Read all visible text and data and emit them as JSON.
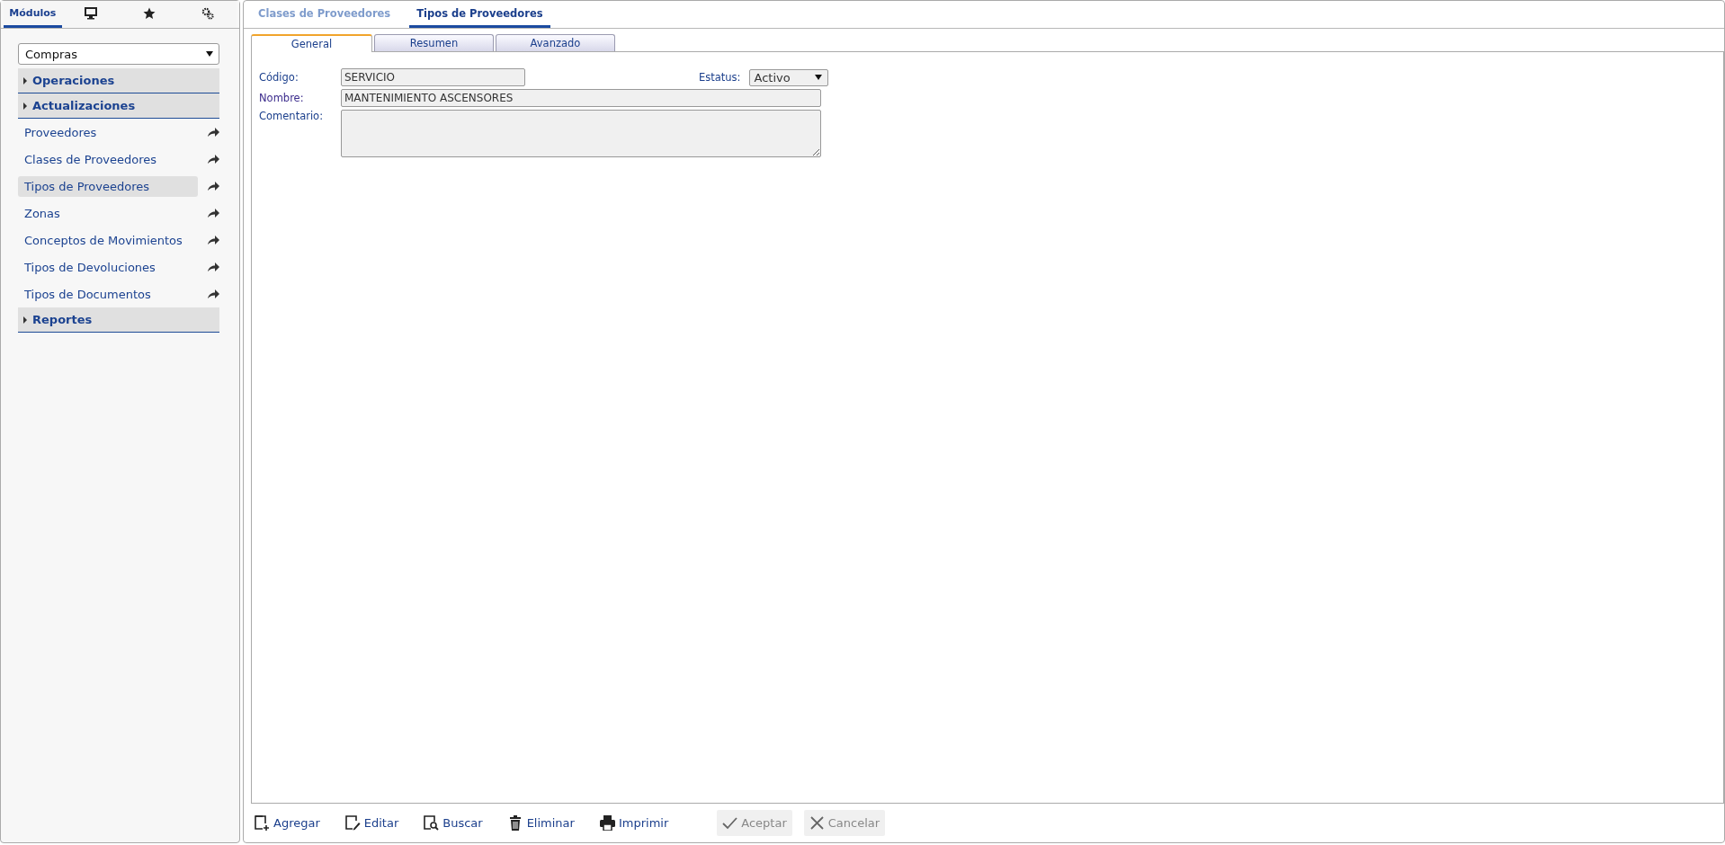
{
  "sidebar": {
    "tabs": [
      {
        "kind": "text",
        "label": "Módulos",
        "selected": true
      },
      {
        "kind": "monitor",
        "selected": false
      },
      {
        "kind": "star",
        "selected": false
      },
      {
        "kind": "gears",
        "selected": false
      }
    ],
    "module_select": {
      "value": "Compras"
    },
    "sections": [
      {
        "label": "Operaciones"
      },
      {
        "label": "Actualizaciones",
        "items": [
          {
            "label": "Proveedores",
            "selected": false
          },
          {
            "label": "Clases de Proveedores",
            "selected": false
          },
          {
            "label": "Tipos de Proveedores",
            "selected": true
          },
          {
            "label": "Zonas",
            "selected": false
          },
          {
            "label": "Conceptos de Movimientos",
            "selected": false
          },
          {
            "label": "Tipos de Devoluciones",
            "selected": false
          },
          {
            "label": "Tipos de Documentos",
            "selected": false
          }
        ]
      },
      {
        "label": "Reportes"
      }
    ]
  },
  "document_tabs": [
    {
      "label": "Clases de Proveedores",
      "selected": false
    },
    {
      "label": "Tipos de Proveedores",
      "selected": true
    }
  ],
  "form_tabs": [
    {
      "label": "General",
      "selected": true
    },
    {
      "label": "Resumen",
      "selected": false
    },
    {
      "label": "Avanzado",
      "selected": false
    }
  ],
  "form": {
    "codigo": {
      "label": "Código:",
      "value": "SERVICIO"
    },
    "estatus": {
      "label": "Estatus:",
      "value": "Activo"
    },
    "nombre": {
      "label": "Nombre:",
      "value": "MANTENIMIENTO ASCENSORES"
    },
    "comentario": {
      "label": "Comentario:"
    }
  },
  "toolbar": [
    {
      "kind": "add",
      "label": "Agregar",
      "disabled": false
    },
    {
      "kind": "edit",
      "label": "Editar",
      "disabled": false
    },
    {
      "kind": "search",
      "label": "Buscar",
      "disabled": false
    },
    {
      "kind": "delete",
      "label": "Eliminar",
      "disabled": false
    },
    {
      "kind": "print",
      "label": "Imprimir",
      "disabled": false
    },
    {
      "kind": "accept",
      "label": "Aceptar",
      "disabled": true
    },
    {
      "kind": "cancel",
      "label": "Cancelar",
      "disabled": true
    }
  ]
}
